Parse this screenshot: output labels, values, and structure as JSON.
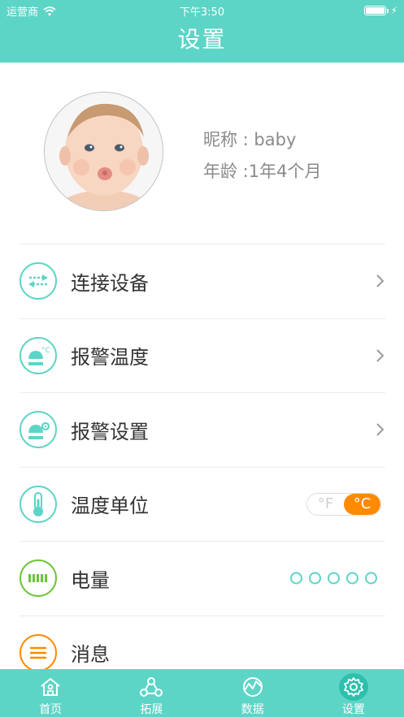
{
  "status_bar": {
    "carrier": "运营商",
    "time": "下午3:50"
  },
  "header": {
    "title": "设置"
  },
  "profile": {
    "nickname": "昵称 : baby",
    "age": "年龄 :1年4个月"
  },
  "menu": [
    {
      "label": "连接设备",
      "icon": "connect-device-icon",
      "accent": "#5dd5c6"
    },
    {
      "label": "报警温度",
      "icon": "alarm-temperature-icon",
      "accent": "#5dd5c6"
    },
    {
      "label": "报警设置",
      "icon": "alarm-settings-icon",
      "accent": "#5dd5c6"
    },
    {
      "label": "温度单位",
      "icon": "thermometer-icon",
      "accent": "#5dd5c6",
      "toggle": {
        "left": "°F",
        "right": "°C",
        "selected": "°C"
      }
    },
    {
      "label": "电量",
      "icon": "battery-icon",
      "accent": "#6bc63a",
      "battery_level_dots": 5
    },
    {
      "label": "消息",
      "icon": "message-icon",
      "accent": "#ff8a00"
    }
  ],
  "tabs": [
    {
      "label": "首页",
      "icon": "home-icon"
    },
    {
      "label": "拓展",
      "icon": "extend-icon"
    },
    {
      "label": "数据",
      "icon": "data-icon"
    },
    {
      "label": "设置",
      "icon": "settings-gear-icon",
      "active": true
    }
  ],
  "colors": {
    "primary": "#5dd5c6",
    "accent_orange": "#ff8a00",
    "battery_green": "#6bc63a"
  }
}
